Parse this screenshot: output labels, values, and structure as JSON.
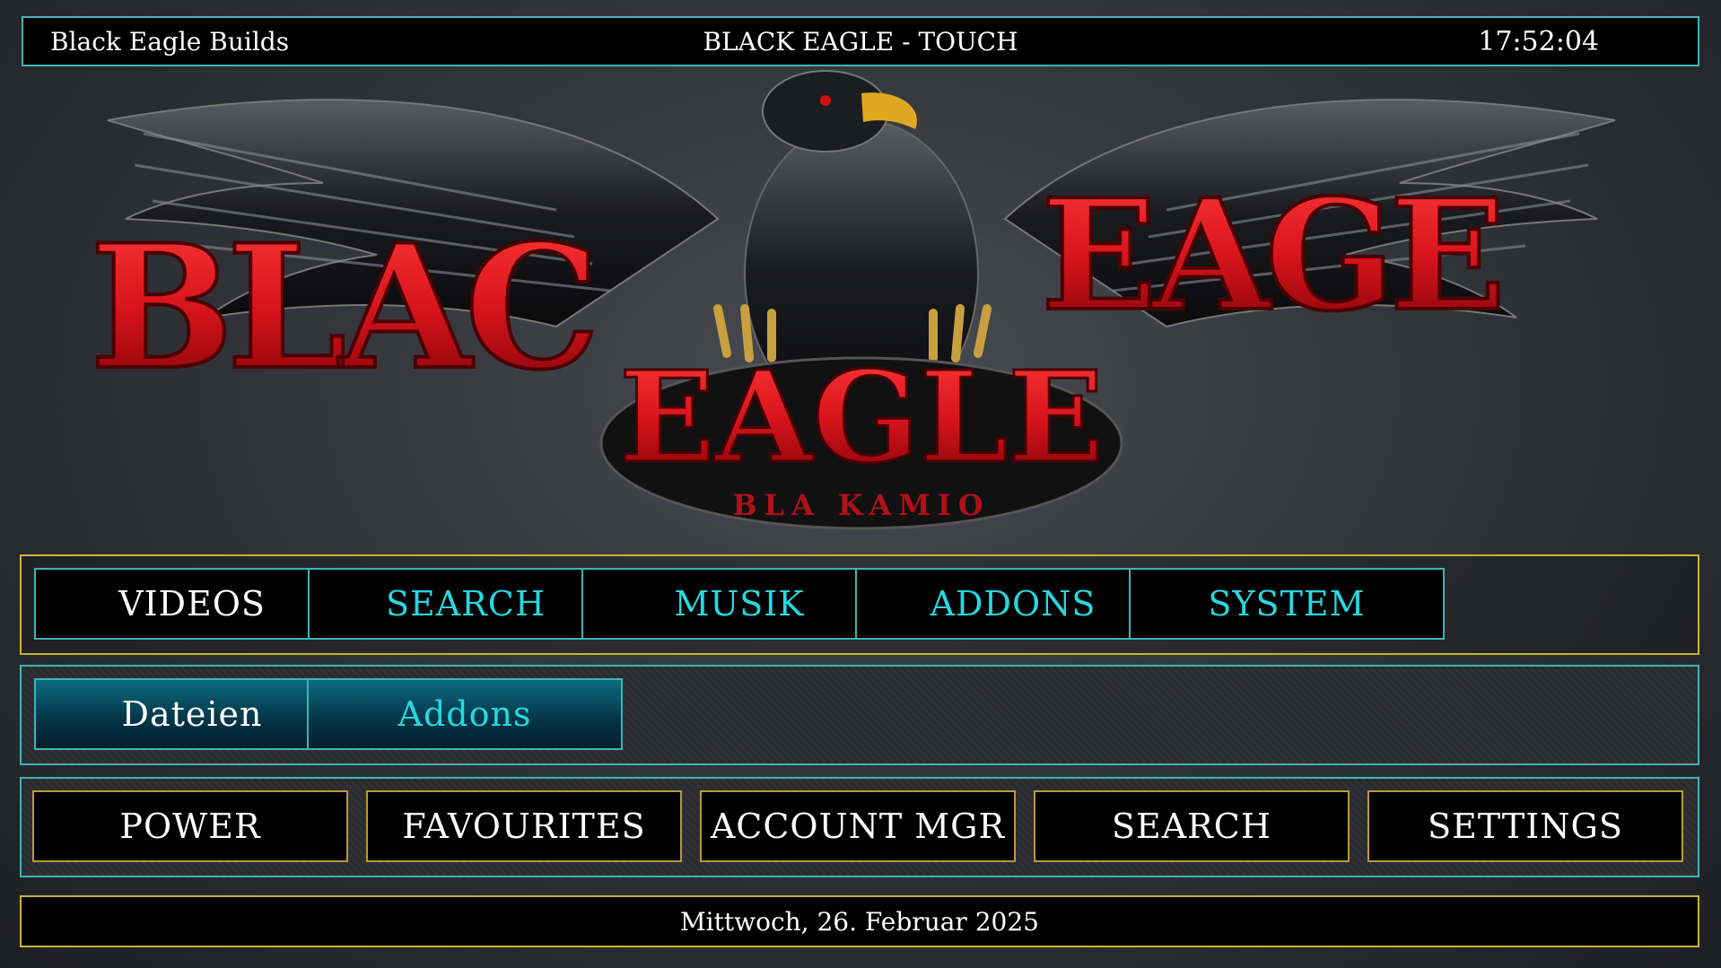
{
  "header": {
    "left_title": "Black Eagle Builds",
    "center_title": "BLACK EAGLE - TOUCH",
    "clock": "17:52:04"
  },
  "hero": {
    "logo_text_left": "BLAC",
    "logo_text_right": "EAGE",
    "logo_text_center": "EAGLE",
    "logo_subtext": "BLA KAMIO"
  },
  "main_menu": {
    "items": [
      {
        "label": "VIDEOS",
        "active": true
      },
      {
        "label": "SEARCH",
        "active": false
      },
      {
        "label": "MUSIK",
        "active": false
      },
      {
        "label": "ADDONS",
        "active": false
      },
      {
        "label": "SYSTEM",
        "active": false
      }
    ]
  },
  "sub_menu": {
    "items": [
      {
        "label": "Dateien",
        "active": true
      },
      {
        "label": "Addons",
        "active": false
      }
    ]
  },
  "bottom_menu": {
    "items": [
      {
        "label": "POWER"
      },
      {
        "label": "FAVOURITES"
      },
      {
        "label": "ACCOUNT MGR"
      },
      {
        "label": "SEARCH"
      },
      {
        "label": "SETTINGS"
      }
    ]
  },
  "footer": {
    "date": "Mittwoch, 26. Februar 2025"
  },
  "colors": {
    "accent_cyan": "#27d8e0",
    "border_teal": "#3fb3b6",
    "border_gold": "#c6b43a",
    "logo_red": "#d8141c"
  }
}
